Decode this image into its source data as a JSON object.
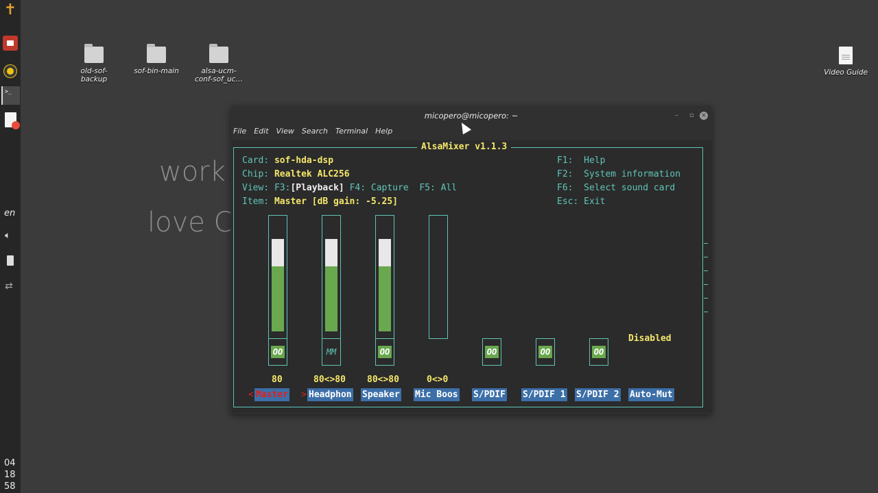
{
  "dock": {
    "lang": "en",
    "clock": [
      "04",
      "18",
      "58"
    ]
  },
  "desktop": {
    "icons": [
      {
        "label": "old-sof-\nbackup"
      },
      {
        "label": "sof-bin-main"
      },
      {
        "label": "alsa-ucm-\nconf-sof_uc…"
      },
      {
        "label": "Video Guide"
      }
    ],
    "bg_text": [
      "work",
      "love C"
    ]
  },
  "window": {
    "title": "micopero@micopero: ~",
    "menu": [
      "File",
      "Edit",
      "View",
      "Search",
      "Terminal",
      "Help"
    ]
  },
  "alsamixer": {
    "title": "AlsaMixer v1.1.3",
    "card_key": "Card:",
    "card_val": "sof-hda-dsp",
    "chip_key": "Chip:",
    "chip_val": "Realtek ALC256",
    "view_key": "View:",
    "view_f3": "F3:",
    "view_playback": "[Playback]",
    "view_f4": "F4: Capture",
    "view_f5": "F5: All",
    "item_key": "Item:",
    "item_val": "Master [dB gain: -5.25]",
    "help": [
      {
        "key": "F1:",
        "text": "Help"
      },
      {
        "key": "F2:",
        "text": "System information"
      },
      {
        "key": "F6:",
        "text": "Select sound card"
      },
      {
        "key": "Esc:",
        "text": "Exit"
      }
    ],
    "channels": [
      {
        "label": "Master",
        "value": "80",
        "mute": "OO",
        "level": 0.8,
        "selected": true
      },
      {
        "label": "Headphon",
        "value": "80<>80",
        "mute": "MM",
        "level": 0.8
      },
      {
        "label": "Speaker",
        "value": "80<>80",
        "mute": "OO",
        "level": 0.8
      },
      {
        "label": "Mic Boos",
        "value": "0<>0",
        "mute": "",
        "level": 0.0
      },
      {
        "label": "S/PDIF",
        "value": "",
        "mute": "OO"
      },
      {
        "label": "S/PDIF 1",
        "value": "",
        "mute": "OO"
      },
      {
        "label": "S/PDIF 2",
        "value": "",
        "mute": "OO"
      },
      {
        "label": "Auto-Mut",
        "value": "Disabled",
        "mute": ""
      }
    ],
    "selected_marker": "<",
    "selected_marker_right": ">"
  }
}
